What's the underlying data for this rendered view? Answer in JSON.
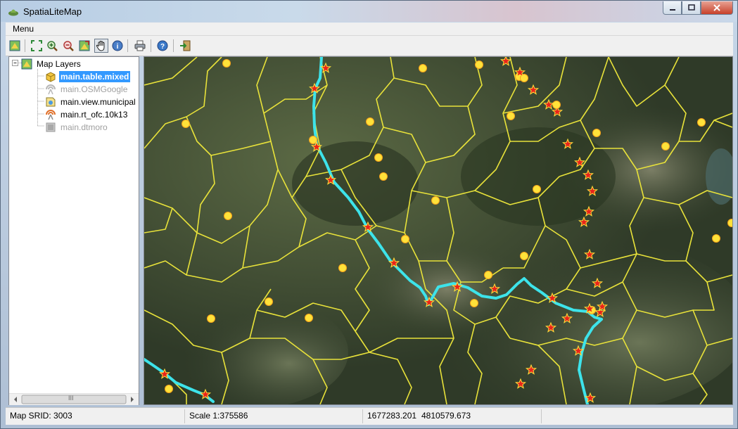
{
  "window": {
    "title": "SpatiaLiteMap"
  },
  "menu": {
    "label": "Menu"
  },
  "toolbar": {
    "buttons": [
      {
        "name": "layer-properties-icon"
      },
      {
        "name": "zoom-full-icon"
      },
      {
        "name": "zoom-in-icon"
      },
      {
        "name": "zoom-out-icon"
      },
      {
        "name": "layer-extent-icon"
      },
      {
        "name": "pan-hand-icon",
        "active": true
      },
      {
        "name": "identify-icon"
      },
      {
        "name": "print-icon"
      },
      {
        "name": "help-icon"
      },
      {
        "name": "exit-icon"
      }
    ]
  },
  "tree": {
    "root": "Map Layers",
    "layers": [
      {
        "label": "main.table.mixed",
        "state": "selected",
        "icon": "table-icon"
      },
      {
        "label": "main.OSMGoogle",
        "state": "disabled",
        "icon": "wms-icon"
      },
      {
        "label": "main.view.municipal",
        "state": "normal",
        "icon": "view-icon"
      },
      {
        "label": "main.rt_ofc.10k13",
        "state": "normal",
        "icon": "wms-icon"
      },
      {
        "label": "main.dtmoro",
        "state": "disabled",
        "icon": "raster-icon"
      }
    ],
    "scroll_grip": "III"
  },
  "status": {
    "srid": "Map SRID: 3003",
    "scale": "Scale 1:375586",
    "x": "1677283.201",
    "y": "4810579.673"
  },
  "colors": {
    "boundary": "#e8e23a",
    "river": "#3de3ea",
    "point": "#ffe23a",
    "star": "#e8231c",
    "selection": "#3399ff"
  }
}
